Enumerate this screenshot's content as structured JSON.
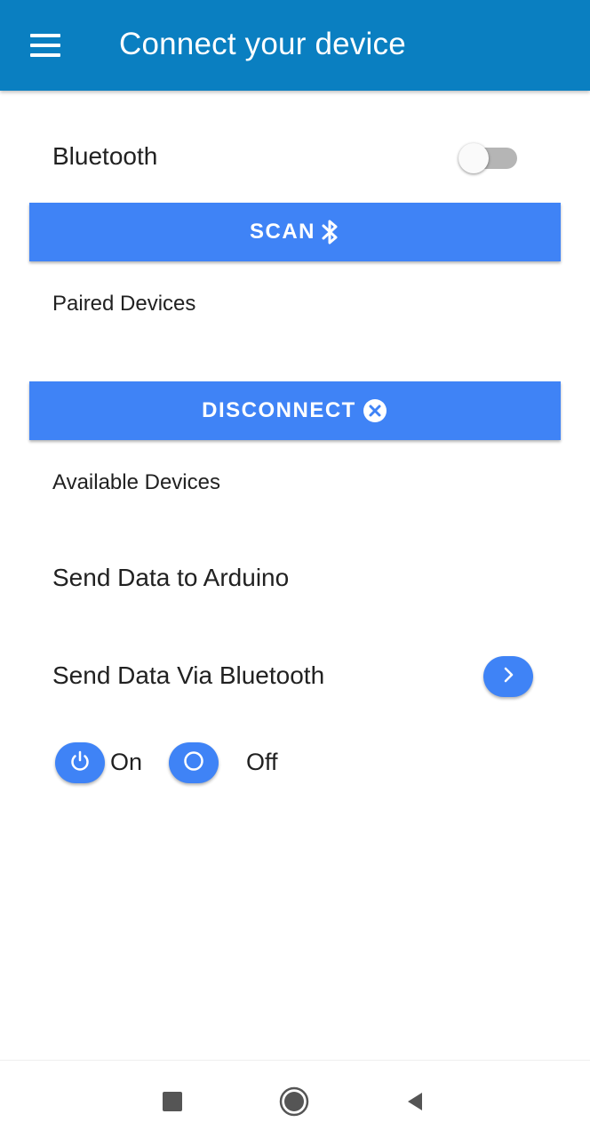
{
  "appbar": {
    "title": "Connect your device",
    "menu_icon": "hamburger-menu-icon",
    "background": "#0a7fc1"
  },
  "bluetooth": {
    "label": "Bluetooth",
    "toggle_on": false
  },
  "scan_button": {
    "label": "SCAN",
    "icon": "bluetooth-icon"
  },
  "paired_devices": {
    "label": "Paired Devices"
  },
  "disconnect_button": {
    "label": "DISCONNECT",
    "icon": "close-circle-icon"
  },
  "available_devices": {
    "label": "Available Devices"
  },
  "send_data_arduino": {
    "label": "Send Data to Arduino"
  },
  "send_via_bluetooth": {
    "label": "Send Data Via Bluetooth",
    "icon": "chevron-right-icon"
  },
  "power_controls": {
    "on_label": "On",
    "on_icon": "power-icon",
    "off_label": "Off",
    "off_icon": "circle-icon"
  },
  "colors": {
    "accent": "#3f83f6",
    "text": "#212121"
  },
  "system_nav": {
    "recents_icon": "square-icon",
    "home_icon": "home-circle-icon",
    "back_icon": "back-triangle-icon"
  }
}
